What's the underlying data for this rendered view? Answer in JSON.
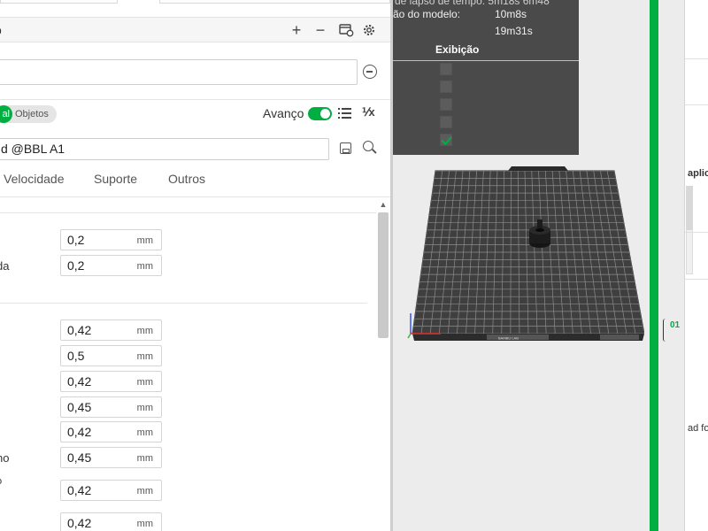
{
  "process": {
    "title": "o",
    "add_label": "+",
    "remove_label": "−"
  },
  "scope": {
    "global_label": "al",
    "objects_label": "Objetos",
    "advanced_label": "Avanço",
    "compare_icon_label": "⅟x"
  },
  "preset": {
    "name": "d @BBL A1"
  },
  "tabs": [
    "Velocidade",
    "Suporte",
    "Outros"
  ],
  "settings": {
    "layer_height": {
      "value": "0,2",
      "unit": "mm"
    },
    "first_layer_height": {
      "label": "da",
      "value": "0,2",
      "unit": "mm"
    },
    "line_widths": [
      {
        "label": "",
        "value": "0,42",
        "unit": "mm"
      },
      {
        "label": "",
        "value": "0,5",
        "unit": "mm"
      },
      {
        "label": "",
        "value": "0,42",
        "unit": "mm"
      },
      {
        "label": "",
        "value": "0,45",
        "unit": "mm"
      },
      {
        "label": "",
        "value": "0,42",
        "unit": "mm"
      },
      {
        "label": "no",
        "value": "0,45",
        "unit": "mm"
      },
      {
        "label": "o",
        "value": "0,42",
        "unit": "mm"
      },
      {
        "label": "",
        "value": "0,42",
        "unit": "mm"
      }
    ]
  },
  "slice_info": {
    "row1": "de lapso de tempo:  5m18s     6m48",
    "row2_label": "ão do modelo:",
    "row2_value": "10m8s",
    "row3_value": "19m31s",
    "visibility_header": "Exibição",
    "visibility_checked": [
      false,
      false,
      false,
      false,
      true
    ]
  },
  "plate": {
    "brand_label": "BAMBU LAB",
    "slider_label": "01"
  },
  "far_right": {
    "text_top": "aplic",
    "text_bottom": "ad fo"
  },
  "colors": {
    "accent": "#00ae42",
    "slice_panel": "#4a4a4a",
    "plate": "#3f3f3f"
  }
}
